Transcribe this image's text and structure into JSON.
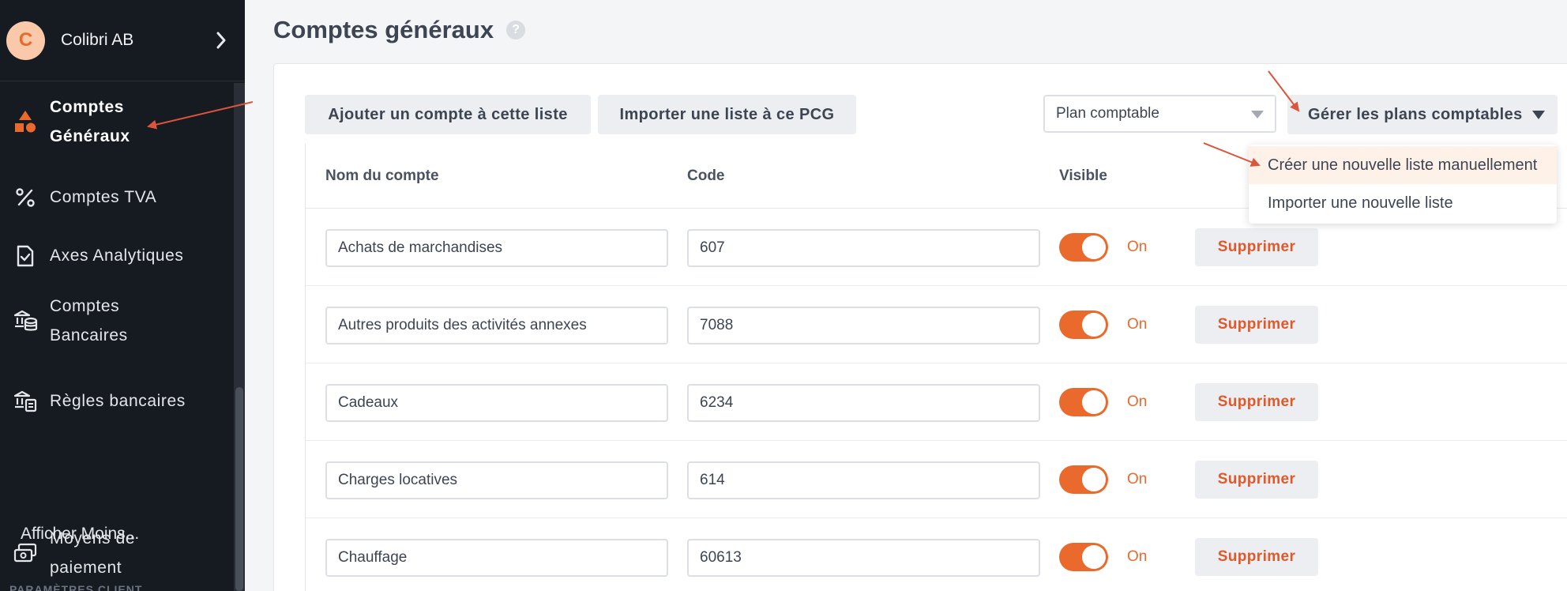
{
  "company": {
    "initial": "C",
    "name": "Colibri AB"
  },
  "sidebar": {
    "items": [
      {
        "label_line1": "Comptes",
        "label_line2": "Généraux",
        "icon": "shapes-icon",
        "active": true
      },
      {
        "label_line1": "Comptes TVA",
        "icon": "percent-icon"
      },
      {
        "label_line1": "Axes Analytiques",
        "icon": "document-check-icon"
      },
      {
        "label_line1": "Comptes",
        "label_line2": "Bancaires",
        "icon": "bank-coins-icon"
      },
      {
        "label_line1": "Règles bancaires",
        "icon": "bank-rules-icon"
      },
      {
        "label_line1": "Moyens de",
        "label_line2": "paiement",
        "icon": "payment-cards-icon"
      }
    ],
    "show_less": "Afficher Moins...",
    "section_title": "PARAMÈTRES CLIENT"
  },
  "page": {
    "title": "Comptes généraux"
  },
  "toolbar": {
    "add_account": "Ajouter un compte à cette liste",
    "import_list": "Importer une liste à ce PCG",
    "plan_select": "Plan comptable",
    "manage_plans": "Gérer les plans comptables"
  },
  "menu": {
    "items": [
      "Créer une nouvelle liste manuellement",
      "Importer une nouvelle liste"
    ]
  },
  "table": {
    "headers": {
      "name": "Nom du compte",
      "code": "Code",
      "visible": "Visible"
    },
    "rows": [
      {
        "name": "Achats de marchandises",
        "code": "607",
        "visible": "On",
        "delete": "Supprimer"
      },
      {
        "name": "Autres produits des activités annexes",
        "code": "7088",
        "visible": "On",
        "delete": "Supprimer"
      },
      {
        "name": "Cadeaux",
        "code": "6234",
        "visible": "On",
        "delete": "Supprimer"
      },
      {
        "name": "Charges locatives",
        "code": "614",
        "visible": "On",
        "delete": "Supprimer"
      },
      {
        "name": "Chauffage",
        "code": "60613",
        "visible": "On",
        "delete": "Supprimer"
      }
    ]
  },
  "colors": {
    "accent": "#ea6a2d",
    "sidebar_bg": "#161b22",
    "annotation_arrow": "#d9553c"
  }
}
